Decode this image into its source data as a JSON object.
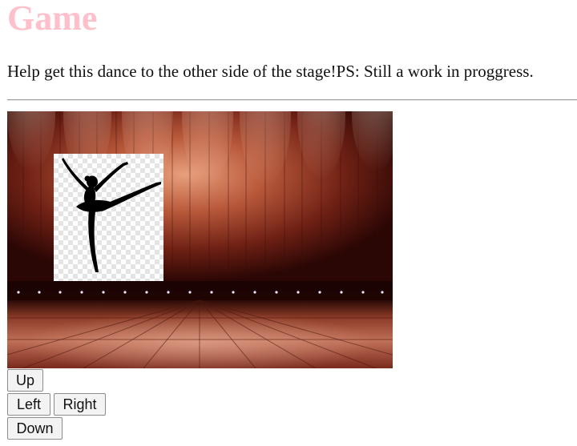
{
  "header": {
    "title": "Game",
    "title_color": "#ffc0cb"
  },
  "intro": {
    "text": "Help get this dance to the other side of the stage!PS: Still a work in proggress."
  },
  "stage": {
    "background": "wooden-stage-with-spotlights",
    "sprite": "ballerina-silhouette"
  },
  "controls": {
    "up_label": "Up",
    "left_label": "Left",
    "right_label": "Right",
    "down_label": "Down"
  }
}
